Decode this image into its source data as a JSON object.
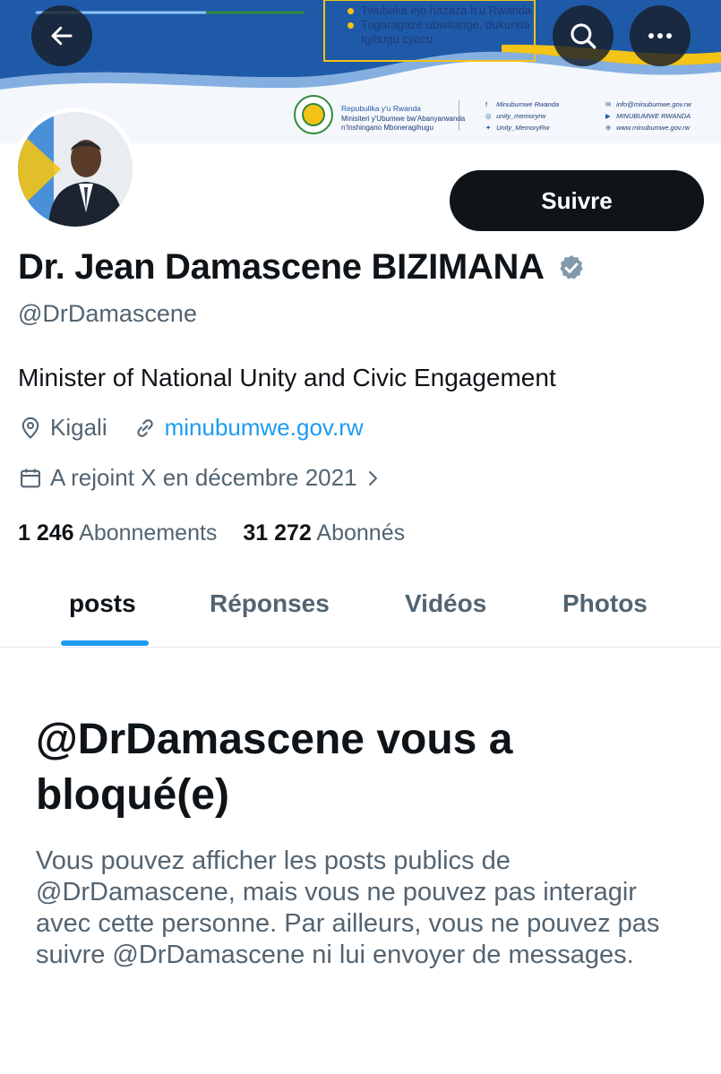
{
  "banner": {
    "bullets": [
      "Twubake ejo hazaza h'u Rwanda",
      "Tugaragaze ubwitange, dukunda",
      "Igihugu cyacu"
    ],
    "ministry": {
      "republic": "Repubulika y'u Rwanda",
      "line1": "Minisiteri y'Ubumwe bw'Abanyarwanda",
      "line2": "n'Inshingano Mboneragihugu"
    },
    "social_left": [
      "Minubumwe Rwanda",
      "unity_memoryrw",
      "Unity_MemoryRw"
    ],
    "social_right": [
      "info@minubumwe.gov.rw",
      "MINUBUMWE RWANDA",
      "www.minubumwe.gov.rw"
    ],
    "colors": {
      "wave_blue": "#1f5aa8",
      "accent_yellow": "#f3c316",
      "green": "#2e8b3c"
    }
  },
  "header_icons": [
    "arrow-left-icon",
    "search-icon",
    "more-icon"
  ],
  "profile": {
    "follow_label": "Suivre",
    "name": "Dr. Jean Damascene BIZIMANA",
    "handle": "@DrDamascene",
    "bio": "Minister of National Unity and Civic Engagement",
    "location": "Kigali",
    "website": "minubumwe.gov.rw",
    "joined": "A rejoint X en décembre 2021",
    "following_count": "1 246",
    "following_label": "Abonnements",
    "followers_count": "31 272",
    "followers_label": "Abonnés"
  },
  "tabs": [
    "posts",
    "Réponses",
    "Vidéos",
    "Photos"
  ],
  "blocked": {
    "title": "@DrDamascene vous a bloqué(e)",
    "text": "Vous pouvez afficher les posts publics de @DrDamascene, mais vous ne pouvez pas interagir avec cette personne. Par ailleurs, vous ne pouvez pas suivre @DrDamascene ni lui envoyer de messages."
  },
  "colors": {
    "accent": "#1d9bf0",
    "text": "#0f1419",
    "muted": "#536471"
  }
}
